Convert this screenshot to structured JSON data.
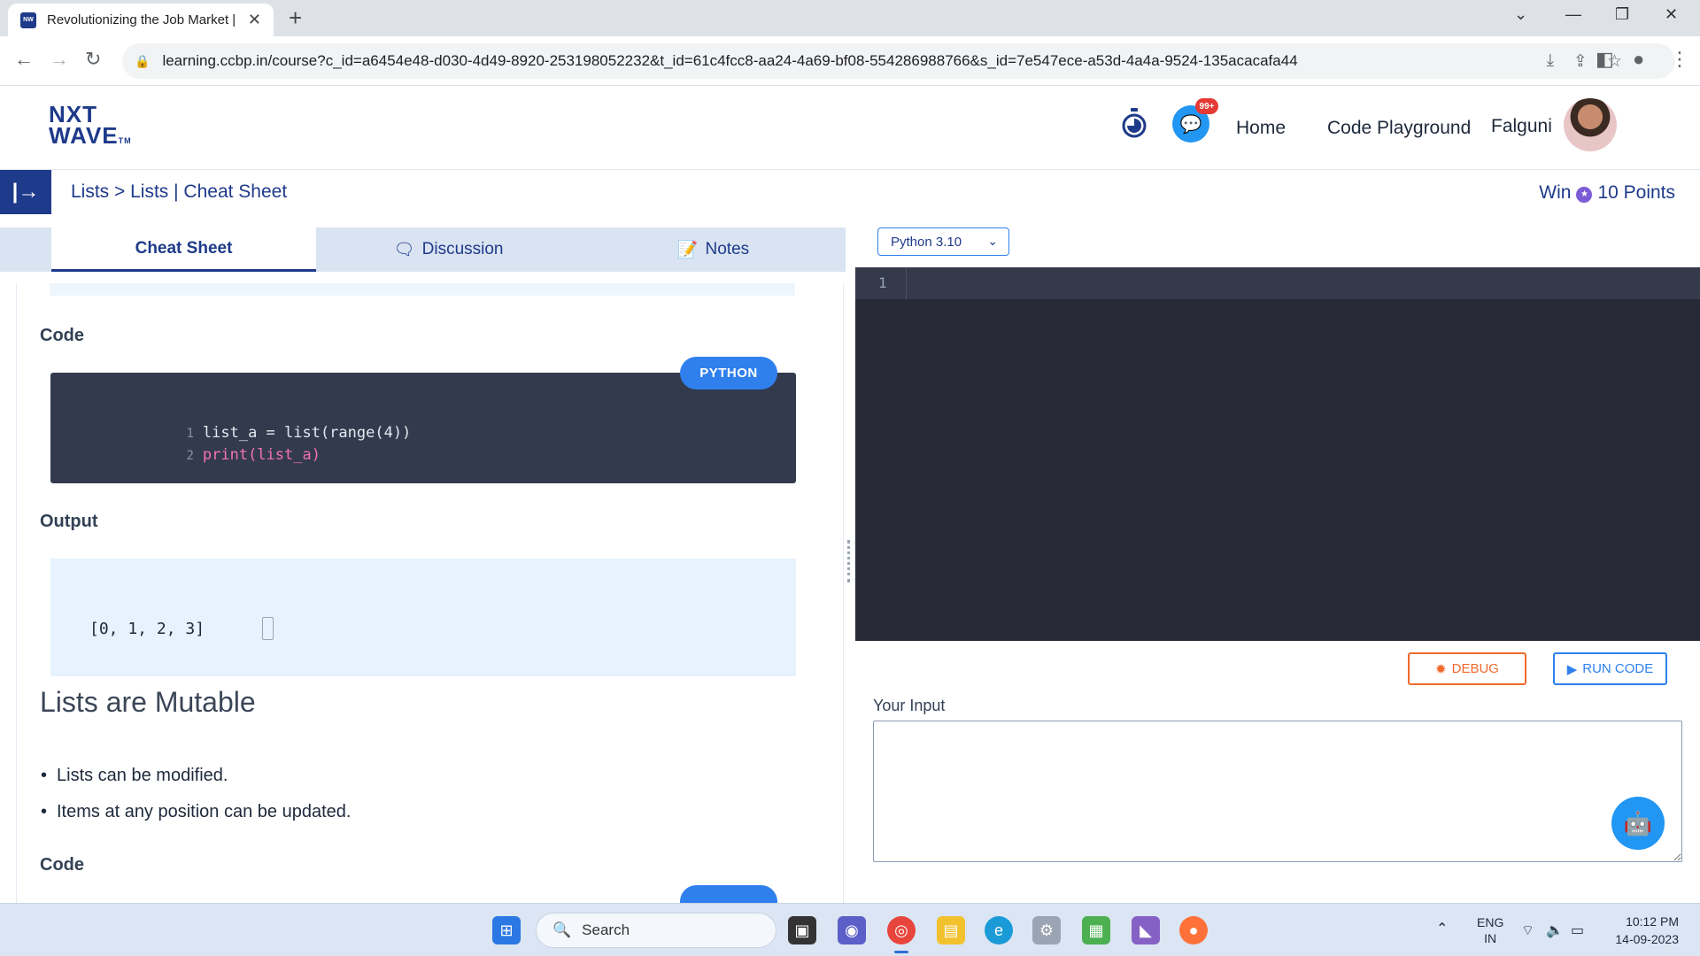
{
  "browser": {
    "tab_title": "Revolutionizing the Job Market |",
    "favicon_text": "NW",
    "url": "learning.ccbp.in/course?c_id=a6454e48-d030-4d49-8920-253198052232&t_id=61c4fcc8-aa24-4a69-bf08-554286988766&s_id=7e547ece-a53d-4a4a-9524-135acacafa44"
  },
  "header": {
    "logo_line1": "NXT",
    "logo_line2": "WAVE",
    "logo_tm": "TM",
    "badge": "99+",
    "nav": {
      "home": "Home",
      "code_playground": "Code Playground"
    },
    "user_name": "Falguni"
  },
  "breadcrumb": {
    "text": "Lists > Lists | Cheat Sheet",
    "win_label": "Win",
    "points": "10 Points"
  },
  "left_tabs": [
    {
      "label": "Cheat Sheet"
    },
    {
      "label": "Discussion"
    },
    {
      "label": "Notes"
    }
  ],
  "cheatsheet": {
    "code_heading": "Code",
    "lang_label": "PYTHON",
    "code_lines": [
      {
        "num": "1",
        "text": "list_a = list(range(4))"
      },
      {
        "num": "2",
        "text": "print(list_a)"
      }
    ],
    "output_heading": "Output",
    "output_text": "[0, 1, 2, 3]",
    "section_title": "Lists are Mutable",
    "bullets": [
      "Lists can be modified.",
      "Items at any position can be updated."
    ],
    "code_heading_2": "Code"
  },
  "editor": {
    "version": "Python 3.10",
    "line_number": "1",
    "debug_label": "DEBUG",
    "run_label": "RUN CODE",
    "input_label": "Your Input"
  },
  "taskbar": {
    "search_label": "Search",
    "lang": "ENG",
    "region": "IN",
    "time": "10:12 PM",
    "date": "14-09-2023"
  },
  "colors": {
    "brand_navy": "#1e3a8a",
    "accent_blue": "#2f80ed",
    "debug_orange": "#f06a2d",
    "editor_bg": "#272a36"
  }
}
